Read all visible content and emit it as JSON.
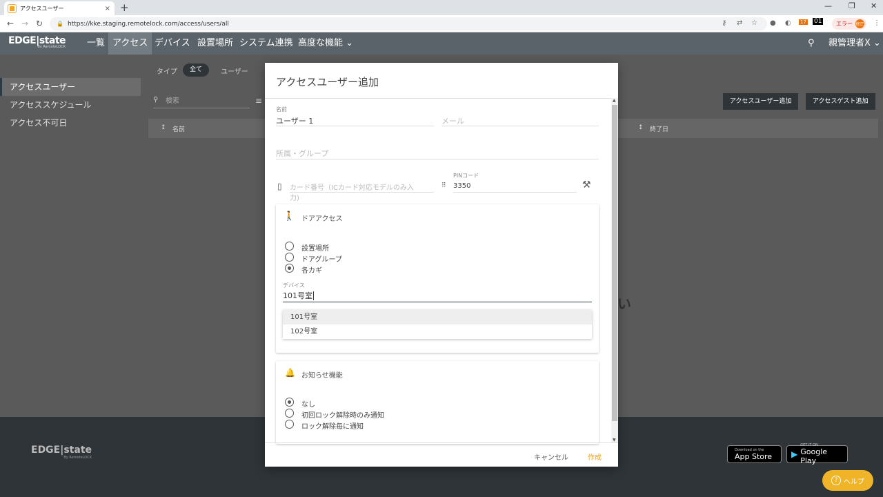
{
  "browser": {
    "tab_title": "アクセスユーザー",
    "tab_close": "×",
    "new_tab": "+",
    "url": "https://kke.staging.remotelock.com/access/users/all",
    "error_label": "エラー",
    "avatar_text": "修正",
    "ext_badge": "01",
    "ext_count": "17"
  },
  "app": {
    "logo_main": "EDGE|state",
    "logo_sub": "By RemoteLOCK",
    "nav": [
      "一覧",
      "アクセス",
      "デバイス",
      "設置場所",
      "システム連携",
      "高度な機能"
    ],
    "user_menu": "親管理者X"
  },
  "sidebar": {
    "items": [
      "アクセスユーザー",
      "アクセススケジュール",
      "アクセス不可日"
    ]
  },
  "filters": {
    "type_label": "タイプ",
    "all": "全て",
    "user": "ユーザー",
    "search_placeholder": "検索"
  },
  "table": {
    "col_name": "名前",
    "col_end": "終了日"
  },
  "page_buttons": {
    "add_user": "アクセスユーザー追加",
    "add_guest": "アクセスゲスト追加"
  },
  "page_partial_text": "い",
  "modal": {
    "title": "アクセスユーザー追加",
    "name_label": "名前",
    "name_value": "ユーザー 1",
    "email_placeholder": "メール",
    "group_placeholder": "所属・グループ",
    "card_placeholder_line1": "カード番号（ICカード対応モデルのみ入",
    "card_placeholder_line2": "力)",
    "pin_label": "PINコード",
    "pin_value": "3350",
    "door_access": {
      "title": "ドアアクセス",
      "options": [
        "設置場所",
        "ドアグループ",
        "各カギ"
      ],
      "selected": "各カギ",
      "device_label": "デバイス",
      "device_value": "101号室",
      "suggestions": [
        "101号室",
        "102号室"
      ]
    },
    "notification": {
      "title": "お知らせ機能",
      "options": [
        "なし",
        "初回ロック解除時のみ通知",
        "ロック解除毎に通知"
      ],
      "selected": "なし"
    },
    "cancel": "キャンセル",
    "create": "作成"
  },
  "footer": {
    "logo_main": "EDGE|state",
    "logo_sub": "By RemoteLOCK",
    "app_store_small": "Download on the",
    "app_store": "App Store",
    "google_small": "GET IT ON",
    "google": "Google Play",
    "help": "ヘルプ"
  },
  "colors": {
    "header_bg": "#5a6369",
    "accent_orange": "#f0b429",
    "dark_button": "#2e3438"
  }
}
